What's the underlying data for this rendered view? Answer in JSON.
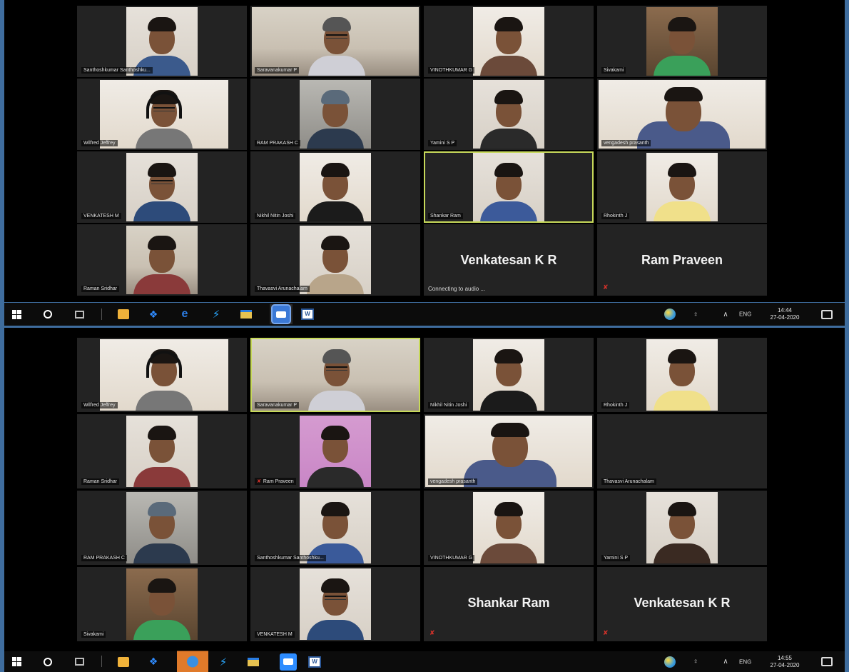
{
  "top_meeting": {
    "tiles": [
      {
        "kind": "video",
        "name": "Santhoshkumar Santhoshku..."
      },
      {
        "kind": "video",
        "name": "Saravanakumar P"
      },
      {
        "kind": "video",
        "name": "VINOTHKUMAR G"
      },
      {
        "kind": "video",
        "name": "Sivakami"
      },
      {
        "kind": "video",
        "name": "Wilfred Jeffrey"
      },
      {
        "kind": "video",
        "name": "RAM PRAKASH C"
      },
      {
        "kind": "video",
        "name": "Yamini S P"
      },
      {
        "kind": "video",
        "name": "vengadesh prasanth"
      },
      {
        "kind": "video",
        "name": "VENKATESH M"
      },
      {
        "kind": "video",
        "name": "Nikhil Nitin Joshi"
      },
      {
        "kind": "video",
        "name": "Shankar Ram",
        "active": true
      },
      {
        "kind": "video",
        "name": "Rhokinth J"
      },
      {
        "kind": "video",
        "name": "Raman Sridhar"
      },
      {
        "kind": "video",
        "name": "Thavasvi Arunachalam"
      },
      {
        "kind": "no-video",
        "big_name": "Venkatesan K R",
        "status": "Connecting to audio ..."
      },
      {
        "kind": "no-video",
        "big_name": "Ram Praveen",
        "muted": true
      }
    ],
    "taskbar": {
      "language": "ENG",
      "time": "14:44",
      "date": "27-04-2020"
    }
  },
  "bottom_meeting": {
    "tiles": [
      {
        "kind": "video",
        "name": "Wilfred Jeffrey"
      },
      {
        "kind": "video",
        "name": "Saravanakumar P",
        "active": true
      },
      {
        "kind": "video",
        "name": "Nikhil Nitin Joshi"
      },
      {
        "kind": "video",
        "name": "Rhokinth J"
      },
      {
        "kind": "video",
        "name": "Raman Sridhar"
      },
      {
        "kind": "video",
        "name": "Ram Praveen",
        "muted": true
      },
      {
        "kind": "video",
        "name": "vengadesh prasanth"
      },
      {
        "kind": "video",
        "name": "Thavasvi Arunachalam"
      },
      {
        "kind": "video",
        "name": "RAM PRAKASH C"
      },
      {
        "kind": "video",
        "name": "Santhoshkumar Santhoshku..."
      },
      {
        "kind": "video",
        "name": "VINOTHKUMAR G"
      },
      {
        "kind": "video",
        "name": "Yamini S P"
      },
      {
        "kind": "video",
        "name": "Sivakami"
      },
      {
        "kind": "video",
        "name": "VENKATESH M"
      },
      {
        "kind": "no-video",
        "big_name": "Shankar Ram",
        "muted": true
      },
      {
        "kind": "no-video",
        "big_name": "Venkatesan K R",
        "muted": true
      }
    ],
    "taskbar": {
      "language": "ENG",
      "time": "14:55",
      "date": "27-04-2020"
    }
  },
  "taskbar_apps": [
    "windows-start",
    "search",
    "task-view",
    "microsoft-store",
    "dropbox",
    "edge",
    "bolt-app",
    "file-explorer",
    "zoom",
    "word"
  ],
  "colors": {
    "active_speaker": "#c7d95a",
    "muted_mic": "#d8322a",
    "tile_bg": "#232323"
  }
}
